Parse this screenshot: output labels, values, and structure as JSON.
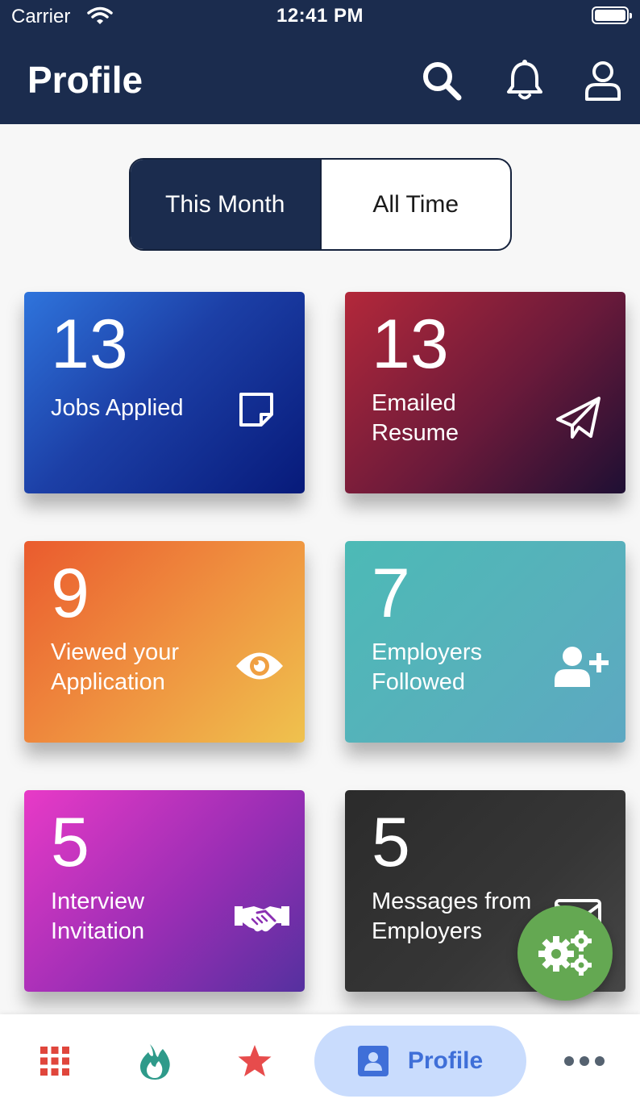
{
  "status_bar": {
    "carrier": "Carrier",
    "time": "12:41 PM"
  },
  "header": {
    "title": "Profile",
    "icons": [
      "search-icon",
      "bell-icon",
      "user-icon"
    ]
  },
  "period_toggle": {
    "options": [
      "This Month",
      "All Time"
    ],
    "selected": "This Month"
  },
  "stats": [
    {
      "count": "13",
      "label_line1": "Jobs Applied",
      "label_line2": "",
      "icon": "sticky-note-icon"
    },
    {
      "count": "13",
      "label_line1": "Emailed",
      "label_line2": "Resume",
      "icon": "paper-plane-icon"
    },
    {
      "count": "9",
      "label_line1": "Viewed your",
      "label_line2": "Application",
      "icon": "eye-icon"
    },
    {
      "count": "7",
      "label_line1": "Employers",
      "label_line2": "Followed",
      "icon": "user-plus-icon"
    },
    {
      "count": "5",
      "label_line1": "Interview",
      "label_line2": "Invitation",
      "icon": "handshake-icon"
    },
    {
      "count": "5",
      "label_line1": "Messages from",
      "label_line2": "Employers",
      "icon": "envelope-icon"
    }
  ],
  "fab": {
    "icon": "gears-icon"
  },
  "tab_bar": {
    "tabs": [
      {
        "icon": "grid-icon",
        "label": ""
      },
      {
        "icon": "fire-icon",
        "label": ""
      },
      {
        "icon": "star-icon",
        "label": ""
      },
      {
        "icon": "profile-card-icon",
        "label": "Profile"
      },
      {
        "icon": "more-icon",
        "label": ""
      }
    ],
    "active": "Profile"
  },
  "colors": {
    "header_bg": "#1b2c4e",
    "tab_active_bg": "#c9dcfd",
    "tab_active_fg": "#3f6fd8",
    "fab_bg": "#64a852",
    "grid_icon": "#e0463c",
    "fire_icon": "#2e9a8a",
    "star_icon": "#e74c4c",
    "more_icon": "#556270"
  }
}
